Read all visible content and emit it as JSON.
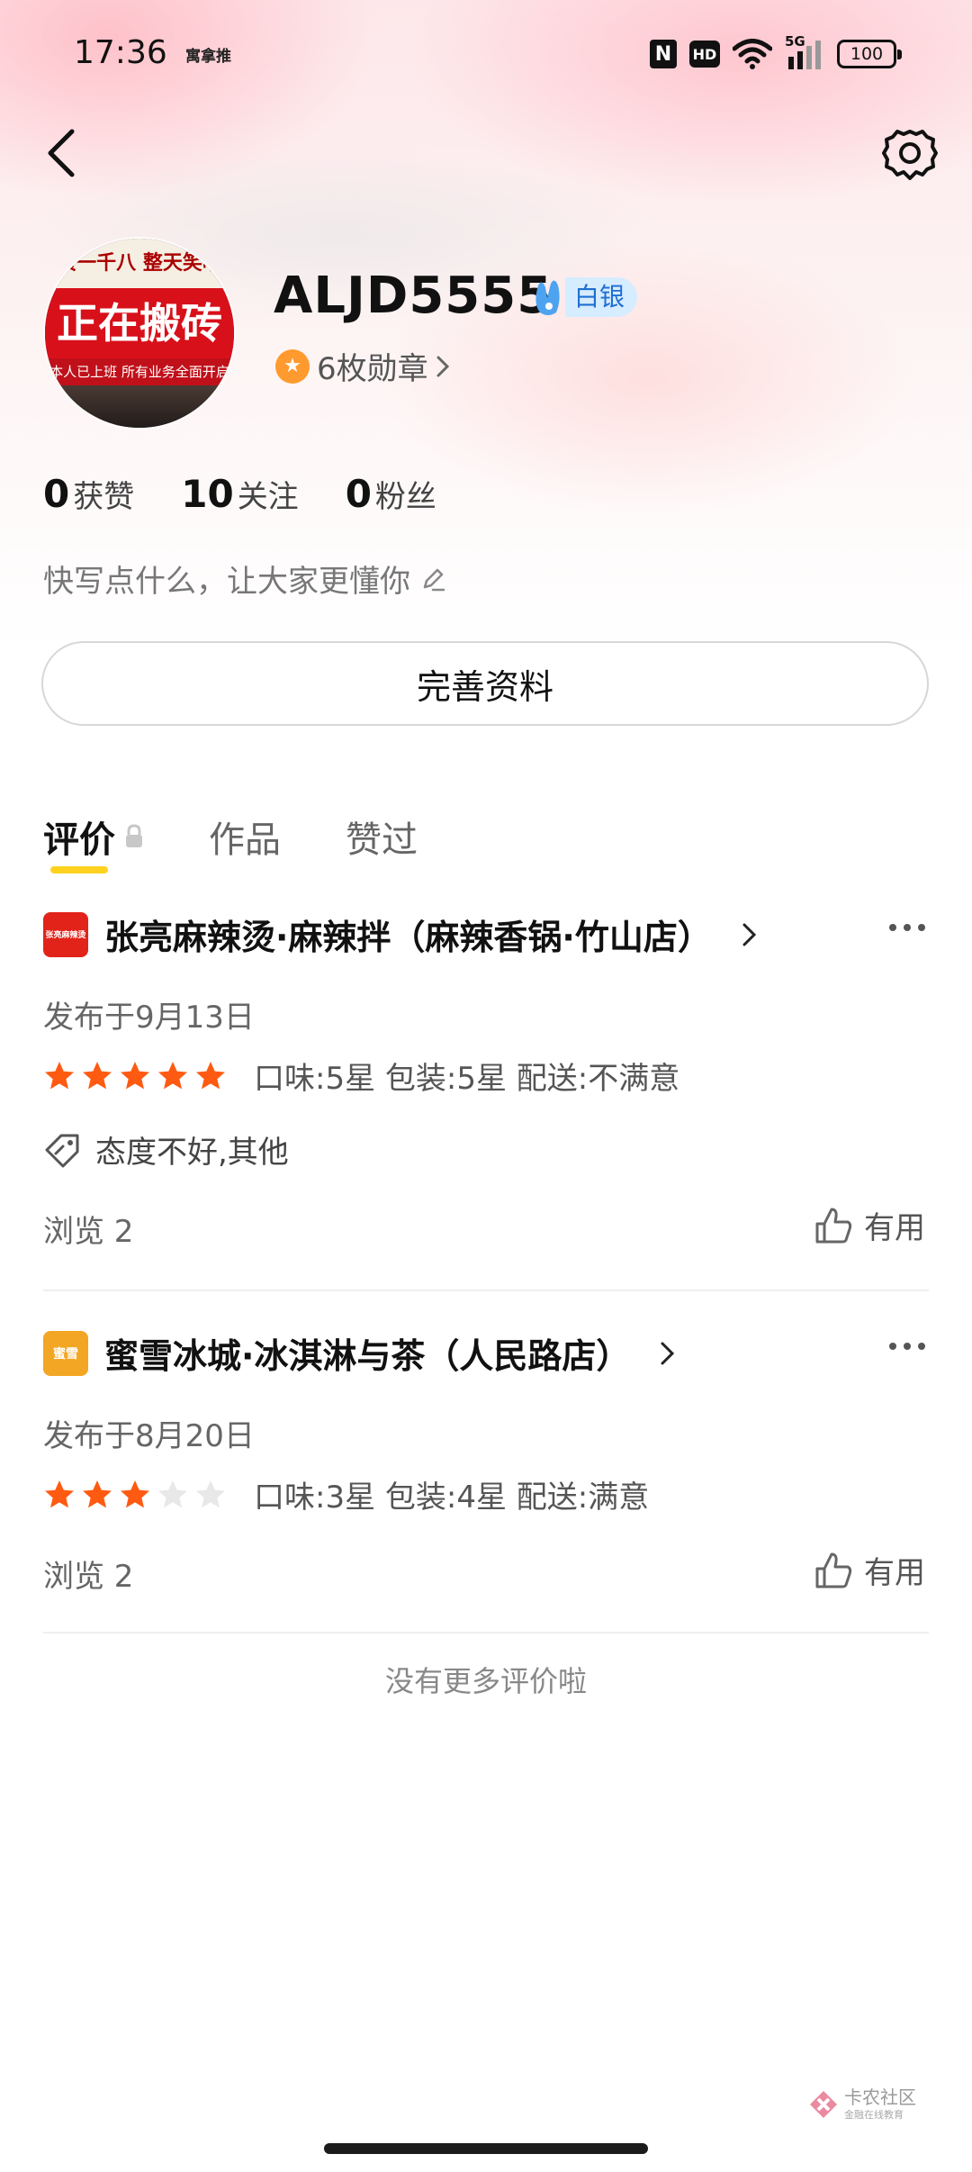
{
  "status_bar": {
    "time": "17:36",
    "carrier_logo": "寓拿推",
    "nfc": "N",
    "hd": "HD",
    "network": "5G",
    "battery": "100"
  },
  "profile": {
    "username": "ALJD5555",
    "level": "白银",
    "medals": "6枚勋章",
    "avatar_text_top": "资一千八 整天笑嘻",
    "avatar_text_main": "正在搬砖",
    "avatar_text_sub": "本人已上班 所有业务全面开启",
    "stats": [
      {
        "value": "0",
        "label": "获赞"
      },
      {
        "value": "10",
        "label": "关注"
      },
      {
        "value": "0",
        "label": "粉丝"
      }
    ],
    "bio_placeholder": "快写点什么，让大家更懂你",
    "complete_button": "完善资料"
  },
  "tabs": [
    {
      "label": "评价",
      "active": true
    },
    {
      "label": "作品",
      "active": false
    },
    {
      "label": "赞过",
      "active": false
    }
  ],
  "reviews": [
    {
      "shop": "张亮麻辣烫·麻辣拌（麻辣香锅·竹山店）",
      "logo_text": "张亮麻辣烫",
      "logo_color": "#e2231a",
      "date": "发布于9月13日",
      "stars": 5,
      "detail": "口味:5星 包装:5星 配送:不满意",
      "tags": "态度不好,其他",
      "views": "浏览 2",
      "useful": "有用"
    },
    {
      "shop": "蜜雪冰城·冰淇淋与茶（人民路店）",
      "logo_text": "蜜雪",
      "logo_color": "#f3a623",
      "date": "发布于8月20日",
      "stars": 3,
      "detail": "口味:3星 包装:4星 配送:满意",
      "tags": "",
      "views": "浏览 2",
      "useful": "有用"
    }
  ],
  "footer": {
    "no_more": "没有更多评价啦",
    "watermark": "卡农社区",
    "watermark_sub": "金融在线教育"
  },
  "colors": {
    "accent_yellow": "#ffd21f",
    "star_orange": "#ff5a12",
    "star_gray": "#e8e8e8",
    "level_blue": "#1f6fd1"
  }
}
